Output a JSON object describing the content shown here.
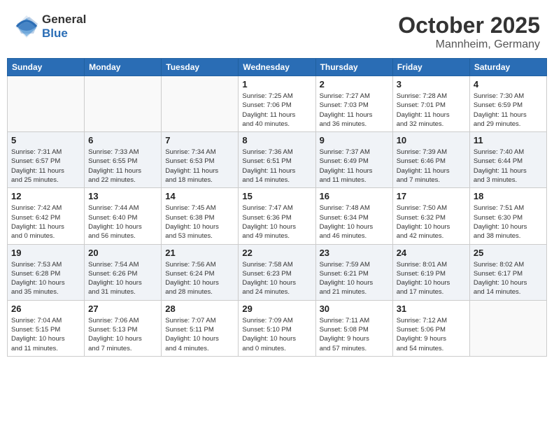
{
  "header": {
    "logo_line1": "General",
    "logo_line2": "Blue",
    "month": "October 2025",
    "location": "Mannheim, Germany"
  },
  "weekdays": [
    "Sunday",
    "Monday",
    "Tuesday",
    "Wednesday",
    "Thursday",
    "Friday",
    "Saturday"
  ],
  "weeks": [
    [
      {
        "day": "",
        "info": ""
      },
      {
        "day": "",
        "info": ""
      },
      {
        "day": "",
        "info": ""
      },
      {
        "day": "1",
        "info": "Sunrise: 7:25 AM\nSunset: 7:06 PM\nDaylight: 11 hours\nand 40 minutes."
      },
      {
        "day": "2",
        "info": "Sunrise: 7:27 AM\nSunset: 7:03 PM\nDaylight: 11 hours\nand 36 minutes."
      },
      {
        "day": "3",
        "info": "Sunrise: 7:28 AM\nSunset: 7:01 PM\nDaylight: 11 hours\nand 32 minutes."
      },
      {
        "day": "4",
        "info": "Sunrise: 7:30 AM\nSunset: 6:59 PM\nDaylight: 11 hours\nand 29 minutes."
      }
    ],
    [
      {
        "day": "5",
        "info": "Sunrise: 7:31 AM\nSunset: 6:57 PM\nDaylight: 11 hours\nand 25 minutes."
      },
      {
        "day": "6",
        "info": "Sunrise: 7:33 AM\nSunset: 6:55 PM\nDaylight: 11 hours\nand 22 minutes."
      },
      {
        "day": "7",
        "info": "Sunrise: 7:34 AM\nSunset: 6:53 PM\nDaylight: 11 hours\nand 18 minutes."
      },
      {
        "day": "8",
        "info": "Sunrise: 7:36 AM\nSunset: 6:51 PM\nDaylight: 11 hours\nand 14 minutes."
      },
      {
        "day": "9",
        "info": "Sunrise: 7:37 AM\nSunset: 6:49 PM\nDaylight: 11 hours\nand 11 minutes."
      },
      {
        "day": "10",
        "info": "Sunrise: 7:39 AM\nSunset: 6:46 PM\nDaylight: 11 hours\nand 7 minutes."
      },
      {
        "day": "11",
        "info": "Sunrise: 7:40 AM\nSunset: 6:44 PM\nDaylight: 11 hours\nand 3 minutes."
      }
    ],
    [
      {
        "day": "12",
        "info": "Sunrise: 7:42 AM\nSunset: 6:42 PM\nDaylight: 11 hours\nand 0 minutes."
      },
      {
        "day": "13",
        "info": "Sunrise: 7:44 AM\nSunset: 6:40 PM\nDaylight: 10 hours\nand 56 minutes."
      },
      {
        "day": "14",
        "info": "Sunrise: 7:45 AM\nSunset: 6:38 PM\nDaylight: 10 hours\nand 53 minutes."
      },
      {
        "day": "15",
        "info": "Sunrise: 7:47 AM\nSunset: 6:36 PM\nDaylight: 10 hours\nand 49 minutes."
      },
      {
        "day": "16",
        "info": "Sunrise: 7:48 AM\nSunset: 6:34 PM\nDaylight: 10 hours\nand 46 minutes."
      },
      {
        "day": "17",
        "info": "Sunrise: 7:50 AM\nSunset: 6:32 PM\nDaylight: 10 hours\nand 42 minutes."
      },
      {
        "day": "18",
        "info": "Sunrise: 7:51 AM\nSunset: 6:30 PM\nDaylight: 10 hours\nand 38 minutes."
      }
    ],
    [
      {
        "day": "19",
        "info": "Sunrise: 7:53 AM\nSunset: 6:28 PM\nDaylight: 10 hours\nand 35 minutes."
      },
      {
        "day": "20",
        "info": "Sunrise: 7:54 AM\nSunset: 6:26 PM\nDaylight: 10 hours\nand 31 minutes."
      },
      {
        "day": "21",
        "info": "Sunrise: 7:56 AM\nSunset: 6:24 PM\nDaylight: 10 hours\nand 28 minutes."
      },
      {
        "day": "22",
        "info": "Sunrise: 7:58 AM\nSunset: 6:23 PM\nDaylight: 10 hours\nand 24 minutes."
      },
      {
        "day": "23",
        "info": "Sunrise: 7:59 AM\nSunset: 6:21 PM\nDaylight: 10 hours\nand 21 minutes."
      },
      {
        "day": "24",
        "info": "Sunrise: 8:01 AM\nSunset: 6:19 PM\nDaylight: 10 hours\nand 17 minutes."
      },
      {
        "day": "25",
        "info": "Sunrise: 8:02 AM\nSunset: 6:17 PM\nDaylight: 10 hours\nand 14 minutes."
      }
    ],
    [
      {
        "day": "26",
        "info": "Sunrise: 7:04 AM\nSunset: 5:15 PM\nDaylight: 10 hours\nand 11 minutes."
      },
      {
        "day": "27",
        "info": "Sunrise: 7:06 AM\nSunset: 5:13 PM\nDaylight: 10 hours\nand 7 minutes."
      },
      {
        "day": "28",
        "info": "Sunrise: 7:07 AM\nSunset: 5:11 PM\nDaylight: 10 hours\nand 4 minutes."
      },
      {
        "day": "29",
        "info": "Sunrise: 7:09 AM\nSunset: 5:10 PM\nDaylight: 10 hours\nand 0 minutes."
      },
      {
        "day": "30",
        "info": "Sunrise: 7:11 AM\nSunset: 5:08 PM\nDaylight: 9 hours\nand 57 minutes."
      },
      {
        "day": "31",
        "info": "Sunrise: 7:12 AM\nSunset: 5:06 PM\nDaylight: 9 hours\nand 54 minutes."
      },
      {
        "day": "",
        "info": ""
      }
    ]
  ]
}
